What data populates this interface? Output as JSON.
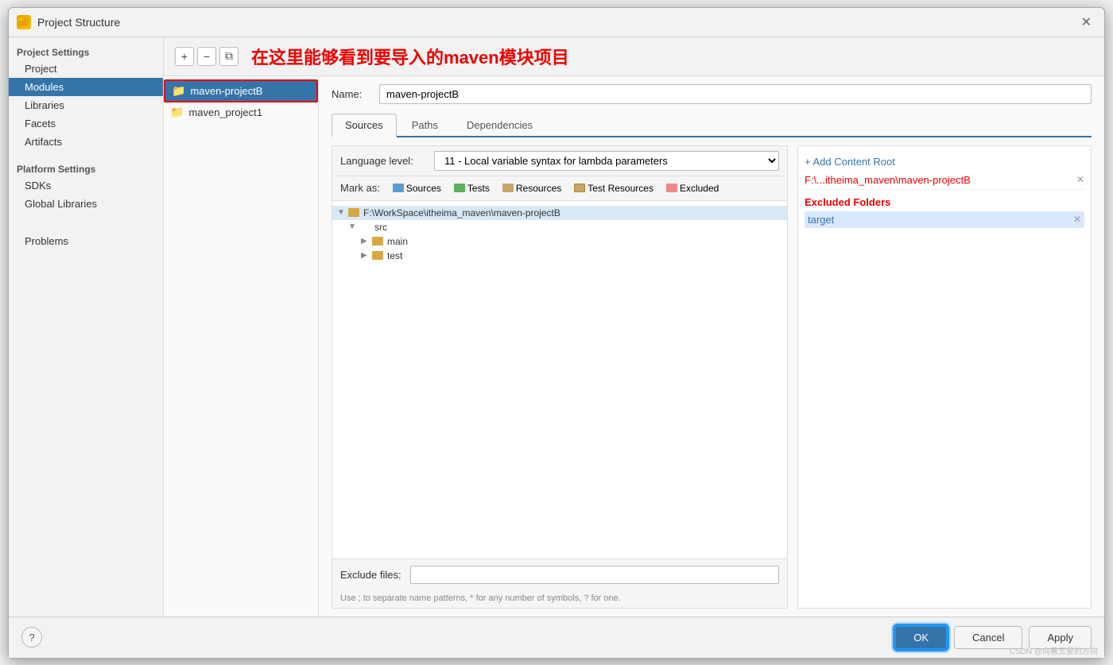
{
  "dialog": {
    "title": "Project Structure",
    "close_label": "✕"
  },
  "toolbar": {
    "add_label": "+",
    "remove_label": "−",
    "copy_label": "⧉",
    "annotation": "在这里能够看到要导入的maven模块项目"
  },
  "sidebar": {
    "project_settings_label": "Project Settings",
    "items": [
      {
        "id": "project",
        "label": "Project"
      },
      {
        "id": "modules",
        "label": "Modules",
        "active": true
      },
      {
        "id": "libraries",
        "label": "Libraries"
      },
      {
        "id": "facets",
        "label": "Facets"
      },
      {
        "id": "artifacts",
        "label": "Artifacts"
      }
    ],
    "platform_settings_label": "Platform Settings",
    "platform_items": [
      {
        "id": "sdks",
        "label": "SDKs"
      },
      {
        "id": "global-libraries",
        "label": "Global Libraries"
      }
    ],
    "problems_label": "Problems"
  },
  "modules": [
    {
      "id": "maven-projectB",
      "label": "maven-projectB",
      "selected": true,
      "highlighted": true
    },
    {
      "id": "maven_project1",
      "label": "maven_project1",
      "selected": false
    }
  ],
  "detail": {
    "name_label": "Name:",
    "name_value": "maven-projectB",
    "tabs": [
      {
        "id": "sources",
        "label": "Sources",
        "active": true
      },
      {
        "id": "paths",
        "label": "Paths"
      },
      {
        "id": "dependencies",
        "label": "Dependencies"
      }
    ],
    "language_level_label": "Language level:",
    "language_level_value": "11 - Local variable syntax for lambda parameters",
    "mark_as_label": "Mark as:",
    "mark_badges": [
      {
        "id": "sources",
        "label": "Sources",
        "color": "sources"
      },
      {
        "id": "tests",
        "label": "Tests",
        "color": "tests"
      },
      {
        "id": "resources",
        "label": "Resources",
        "color": "resources"
      },
      {
        "id": "test-resources",
        "label": "Test Resources",
        "color": "test-resources"
      },
      {
        "id": "excluded",
        "label": "Excluded",
        "color": "excluded"
      }
    ],
    "tree": {
      "root_path": "F:\\WorkSpace\\itheima_maven\\maven-projectB",
      "children": [
        {
          "label": "src",
          "children": [
            {
              "label": "main"
            },
            {
              "label": "test"
            }
          ]
        }
      ]
    },
    "exclude_files_label": "Exclude files:",
    "exclude_files_value": "",
    "exclude_hint": "Use ; to separate name patterns, * for any number of symbols, ? for one.",
    "add_content_root_label": "+ Add Content Root",
    "content_root_path": "F:\\...itheima_maven\\maven-projectB",
    "excluded_folders_label": "Excluded Folders",
    "excluded_folders": [
      {
        "label": "target"
      }
    ]
  },
  "footer": {
    "ok_label": "OK",
    "cancel_label": "Cancel",
    "apply_label": "Apply",
    "help_label": "?"
  },
  "watermark": "CSDN @向着五星的方向"
}
